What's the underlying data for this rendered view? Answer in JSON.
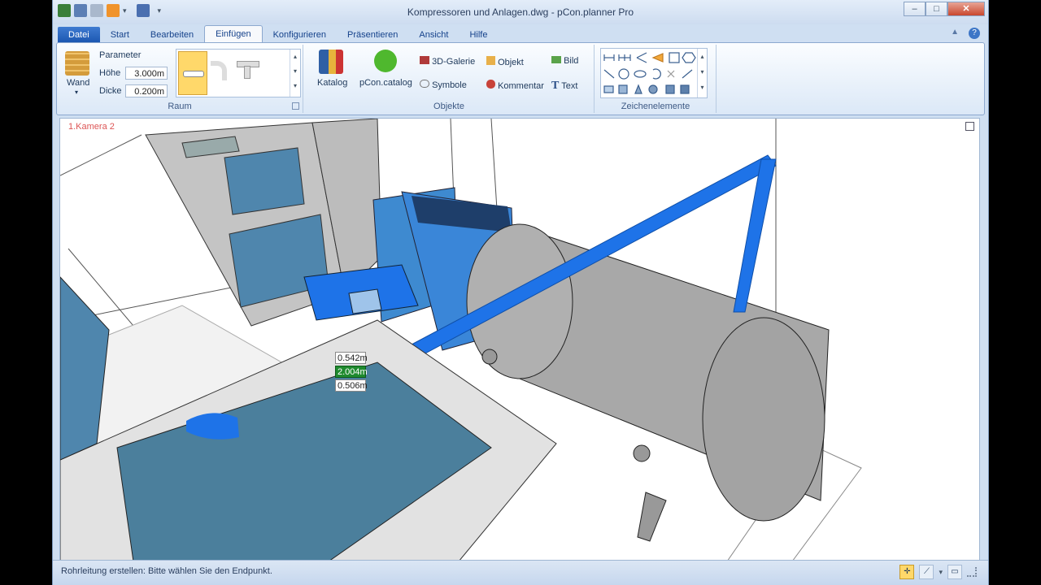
{
  "window": {
    "title": "Kompressoren und Anlagen.dwg - pCon.planner Pro",
    "minimize": "–",
    "maximize": "□",
    "close": "✕"
  },
  "tabs": [
    "Datei",
    "Start",
    "Bearbeiten",
    "Einfügen",
    "Konfigurieren",
    "Präsentieren",
    "Ansicht",
    "Hilfe"
  ],
  "ribbon": {
    "raum": {
      "wand_label": "Wand",
      "parameter_label": "Parameter",
      "hoehe_label": "Höhe",
      "hoehe_value": "3.000m",
      "dicke_label": "Dicke",
      "dicke_value": "0.200m",
      "group_label": "Raum"
    },
    "objekte": {
      "katalog_label": "Katalog",
      "pcon_catalog_label": "pCon.catalog",
      "galerie_label": "3D-Galerie",
      "symbole_label": "Symbole",
      "objekt_label": "Objekt",
      "kommentar_label": "Kommentar",
      "bild_label": "Bild",
      "text_label": "Text",
      "group_label": "Objekte"
    },
    "zeichenelemente": {
      "group_label": "Zeichenelemente"
    }
  },
  "viewport": {
    "camera_label": "1.Kamera 2",
    "measurements": [
      "0.542m",
      "2.004m",
      "0.506m"
    ]
  },
  "status": {
    "text": "Rohrleitung erstellen: Bitte wählen Sie den Endpunkt."
  },
  "colors": {
    "accent": "#1e73e8",
    "machine": "#4f86ad",
    "tank": "#a8a8a8"
  }
}
